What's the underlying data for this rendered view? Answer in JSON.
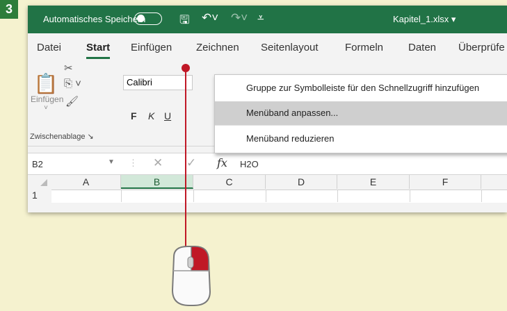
{
  "step": "3",
  "titlebar": {
    "autosave": "Automatisches Speichern",
    "filename": "Kapitel_1.xlsx ▾"
  },
  "tabs": [
    "Datei",
    "Start",
    "Einfügen",
    "Zeichnen",
    "Seitenlayout",
    "Formeln",
    "Daten",
    "Überprüfe"
  ],
  "ribbon": {
    "paste_label": "Einfügen",
    "group_label": "Zwischenablage",
    "font_name": "Calibri",
    "bold": "F",
    "italic": "K",
    "underline": "U"
  },
  "formula": {
    "name_box": "B2",
    "fx": "fx",
    "value": "H2O"
  },
  "columns": [
    "A",
    "B",
    "C",
    "D",
    "E",
    "F"
  ],
  "row": "1",
  "context_menu": {
    "items": [
      "Gruppe zur Symbolleiste für den Schnellzugriff hinzufügen",
      "Menüband anpassen...",
      "Menüband reduzieren"
    ],
    "highlighted_index": 1
  },
  "colors": {
    "excel_green": "#217346",
    "pointer_red": "#c01826",
    "badge": "#2e7d3a",
    "background": "#f5f2cf"
  }
}
